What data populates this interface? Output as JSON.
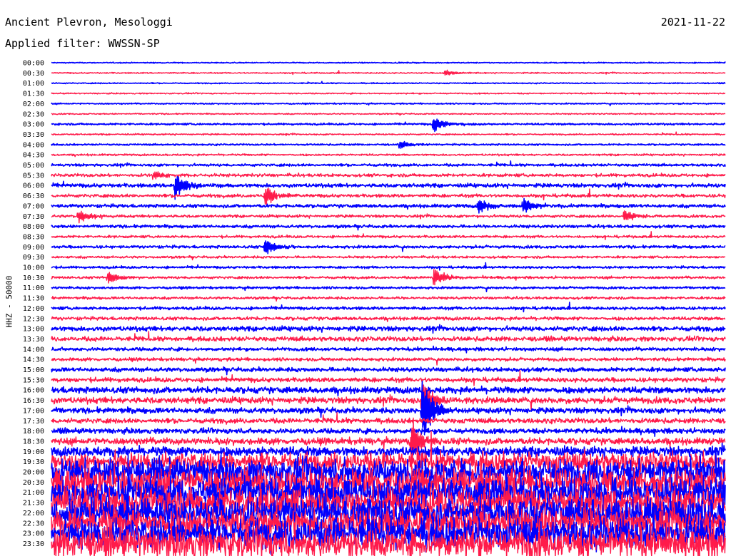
{
  "header": {
    "station": "Ancient Plevron, Mesologgi",
    "filter": "Applied filter: WWSSN-SP",
    "date": "2021-11-22"
  },
  "chart_data": {
    "type": "line",
    "ylabel": "HHZ - 50000",
    "row_labels": [
      "00:00",
      "00:30",
      "01:00",
      "01:30",
      "02:00",
      "02:30",
      "03:00",
      "03:30",
      "04:00",
      "04:30",
      "05:00",
      "05:30",
      "06:00",
      "06:30",
      "07:00",
      "07:30",
      "08:00",
      "08:30",
      "09:00",
      "09:30",
      "10:00",
      "10:30",
      "11:00",
      "11:30",
      "12:00",
      "12:30",
      "13:00",
      "13:30",
      "14:00",
      "14:30",
      "15:00",
      "15:30",
      "16:00",
      "16:30",
      "17:00",
      "17:30",
      "18:00",
      "18:30",
      "19:00",
      "19:30",
      "20:00",
      "20:30",
      "21:00",
      "21:30",
      "22:00",
      "22:30",
      "23:00",
      "23:30"
    ],
    "trace_colors": [
      "#0000ff",
      "#ff1a4a"
    ],
    "noise_levels": [
      0.5,
      0.6,
      0.5,
      0.6,
      0.6,
      0.6,
      0.9,
      0.7,
      0.8,
      0.9,
      1.2,
      1.5,
      1.8,
      1.6,
      1.6,
      1.3,
      1.4,
      1.2,
      1.3,
      1.1,
      1.1,
      1.2,
      1.1,
      1.2,
      1.4,
      1.6,
      2.2,
      2.2,
      1.6,
      1.6,
      2.0,
      2.2,
      3.0,
      3.0,
      2.6,
      2.4,
      2.4,
      3.2,
      4.5,
      9,
      12,
      13,
      14,
      14,
      14,
      14,
      14,
      14
    ],
    "events": [
      {
        "row": 1,
        "minute": 17.5,
        "amp": 5
      },
      {
        "row": 6,
        "minute": 17.0,
        "amp": 12
      },
      {
        "row": 8,
        "minute": 15.5,
        "amp": 7
      },
      {
        "row": 11,
        "minute": 4.5,
        "amp": 8
      },
      {
        "row": 12,
        "minute": 5.5,
        "amp": 20
      },
      {
        "row": 13,
        "minute": 9.5,
        "amp": 16
      },
      {
        "row": 14,
        "minute": 19.0,
        "amp": 12
      },
      {
        "row": 14,
        "minute": 21.0,
        "amp": 12
      },
      {
        "row": 15,
        "minute": 1.2,
        "amp": 12
      },
      {
        "row": 15,
        "minute": 25.5,
        "amp": 10
      },
      {
        "row": 18,
        "minute": 9.5,
        "amp": 14
      },
      {
        "row": 21,
        "minute": 2.5,
        "amp": 12
      },
      {
        "row": 21,
        "minute": 17.0,
        "amp": 14
      },
      {
        "row": 33,
        "minute": 16.5,
        "amp": 35
      },
      {
        "row": 34,
        "minute": 16.5,
        "amp": 50
      },
      {
        "row": 37,
        "minute": 16.0,
        "amp": 40
      }
    ]
  }
}
